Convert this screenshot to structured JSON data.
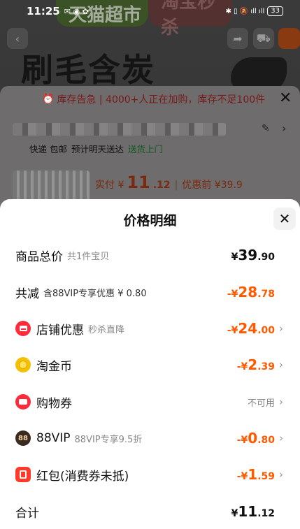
{
  "status_bar": {
    "time": "11:25",
    "indicators_left": "✉ ◉ ✿",
    "indicators_right": "✱ ▯ 🔕 ıll ıll",
    "battery": "33"
  },
  "background": {
    "tmall_tag": "天猫超市",
    "taobao_tag": "淘宝秒杀",
    "hero_title": "刷毛含炭",
    "stock_alert": "库存告急 | 4000+人正在加购，库存不足100件",
    "shipping": {
      "a": "快递 包邮",
      "b": "预计明天送达",
      "c": "送货上门"
    },
    "price": {
      "prefix": "实付 ¥",
      "int": "11",
      "dec": ".12",
      "sep": "|",
      "before": "优惠前 ¥39.9"
    }
  },
  "sheet": {
    "title": "价格明细",
    "rows": [
      {
        "label": "商品总价",
        "sub": "共1件宝贝",
        "yen": "¥",
        "int": "39",
        "dec": ".90"
      },
      {
        "label": "共减",
        "sub": "含88VIP专享优惠 ¥ 0.80",
        "yen": "-¥",
        "int": "28",
        "dec": ".78"
      },
      {
        "label": "店铺优惠",
        "sub": "秒杀直降",
        "yen": "-¥",
        "int": "24",
        "dec": ".00"
      },
      {
        "label": "淘金币",
        "sub": "",
        "yen": "-¥",
        "int": "2",
        "dec": ".39"
      },
      {
        "label": "购物券",
        "sub": "",
        "status": "不可用"
      },
      {
        "label": "88VIP",
        "sub": "88VIP专享9.5折",
        "yen": "-¥",
        "int": "0",
        "dec": ".80"
      },
      {
        "label": "红包(消费券未抵)",
        "sub": "",
        "yen": "-¥",
        "int": "1",
        "dec": ".59"
      },
      {
        "label": "合计",
        "sub": "",
        "yen": "¥",
        "int": "11",
        "dec": ".12"
      }
    ],
    "vip_badge": "88"
  },
  "colors": {
    "discount_orange": "#ff5a00",
    "icon_red": "#ff2b3a",
    "coin_gold": "#f5c000"
  },
  "icons": [
    "back-icon",
    "share-icon",
    "cart-icon",
    "more-icon",
    "alarm-icon",
    "edit-icon",
    "chevron-right-icon",
    "close-icon",
    "store-icon",
    "coin-icon",
    "voucher-icon",
    "vip-icon",
    "red-packet-icon"
  ]
}
